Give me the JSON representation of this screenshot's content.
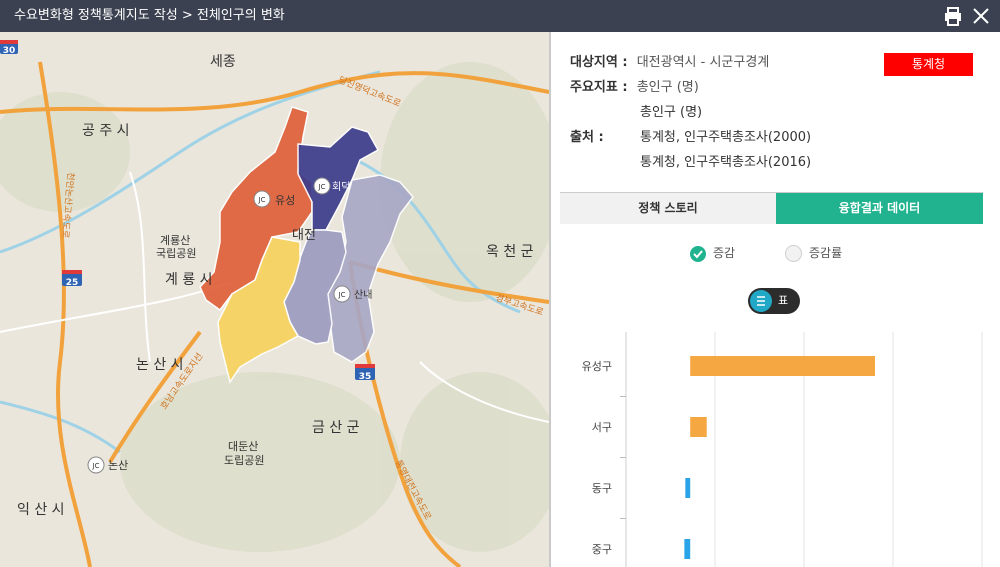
{
  "window": {
    "title": "수요변화형 정책통계지도 작성 > 전체인구의 변화"
  },
  "map": {
    "places": [
      {
        "name": "세종"
      },
      {
        "name": "공 주 시"
      },
      {
        "name": "계룡산"
      },
      {
        "name": "국립공원"
      },
      {
        "name": "계 룡 시"
      },
      {
        "name": "논 산 시"
      },
      {
        "name": "대둔산"
      },
      {
        "name": "도립공원"
      },
      {
        "name": "익 산 시"
      },
      {
        "name": "금 산 군"
      },
      {
        "name": "옥 천 군"
      },
      {
        "name": "대전"
      },
      {
        "name": "유성"
      },
      {
        "name": "회덕"
      },
      {
        "name": "산내"
      },
      {
        "name": "논산"
      }
    ],
    "route_shields": [
      "30",
      "25",
      "35"
    ],
    "road_labels": [
      "당진영덕고속도로",
      "경부고속도로",
      "통영대전고속도로",
      "천안논산고속도로",
      "호남고속도로지선"
    ],
    "region_colors": {
      "yuseong": "#e0603a",
      "daedeok": "#3c3c8c",
      "seogu": "#f8d25e",
      "junggu": "#9c9cbf",
      "donggu": "#a7a7c6"
    }
  },
  "info": {
    "region_label": "대상지역 :",
    "region_value": "대전광역시 - 시군구경계",
    "indicator_label": "주요지표 :",
    "indicator_values": [
      "총인구 (명)",
      "총인구 (명)"
    ],
    "source_label": "출처 :",
    "source_values": [
      "통계청, 인구주택총조사(2000)",
      "통계청, 인구주택총조사(2016)"
    ],
    "badge": "통계청"
  },
  "tabs": [
    {
      "label": "정책 스토리",
      "active": false
    },
    {
      "label": "융합결과 데이터",
      "active": true
    }
  ],
  "radios": [
    {
      "label": "증감",
      "checked": true
    },
    {
      "label": "증감률",
      "checked": false
    }
  ],
  "view_toggle": {
    "label": "표"
  },
  "chart_data": {
    "type": "bar",
    "orientation": "horizontal",
    "categories": [
      "유성구",
      "서구",
      "동구",
      "중구"
    ],
    "values": [
      95000,
      8500,
      -2500,
      -3000
    ],
    "xlim": [
      -33000,
      150000
    ],
    "grid": true,
    "colors": {
      "positive": "#f5a742",
      "negative": "#2aa4e8"
    }
  }
}
